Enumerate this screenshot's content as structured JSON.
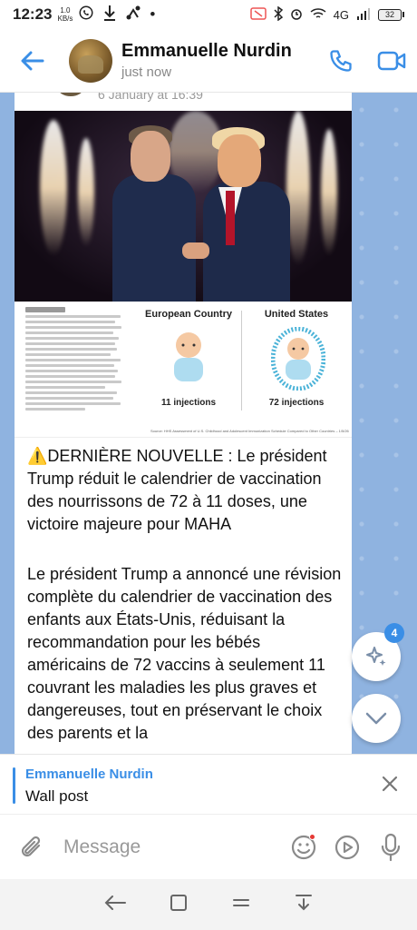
{
  "status_bar": {
    "time": "12:23",
    "speed_value": "1.0",
    "speed_unit": "KB/s",
    "network": "4G",
    "battery": "32"
  },
  "header": {
    "name": "Emmanuelle Nurdin",
    "status": "just now"
  },
  "post": {
    "forward_date": "6 January at 16:39",
    "infographic": {
      "col1_title": "European Country",
      "col1_value": "11 injections",
      "col2_title": "United States",
      "col2_value": "72 injections",
      "source": "Source: HHS Assessment of U.S. Childhood and Adolescent Immunization Schedule Compared to Other Countries – 1/5/26"
    },
    "headline_prefix": "⚠️",
    "headline_bold": "DERNIÈRE NOUVELLE",
    "headline_rest": " : Le président Trump réduit le calendrier de vaccination des nourrissons de 72 à 11 doses, une victoire majeure pour MAHA",
    "body": "Le président Trump a annoncé une révision complète du calendrier de vaccination des enfants aux États-Unis, réduisant la recommandation pour les bébés américains de 72 vaccins à seulement 11 couvrant les maladies les plus graves et dangereuses, tout en préservant le choix des parents et la"
  },
  "fab": {
    "badge_count": "4"
  },
  "reply": {
    "name": "Emmanuelle Nurdin",
    "text": "Wall post"
  },
  "input": {
    "placeholder": "Message"
  },
  "colors": {
    "accent": "#3a8ee6",
    "chat_bg": "#8fb3e0"
  }
}
